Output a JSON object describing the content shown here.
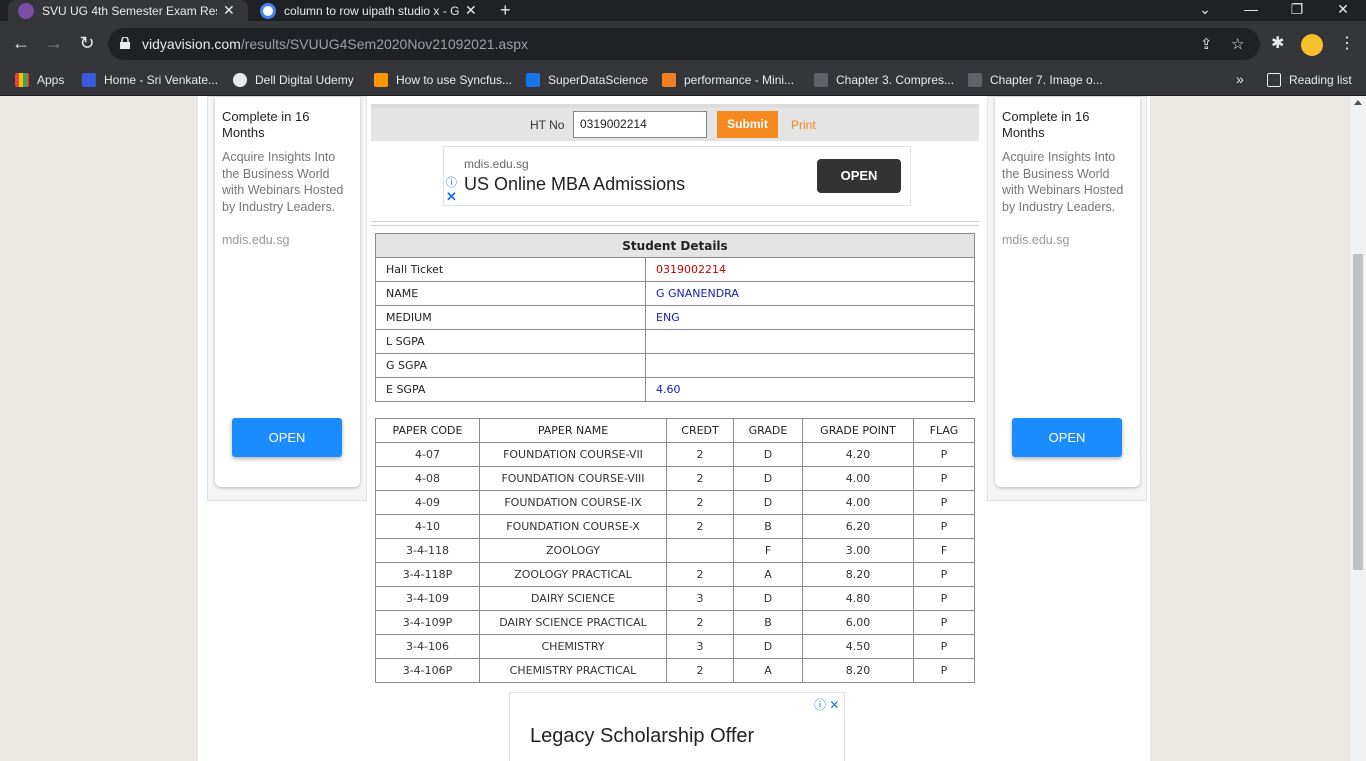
{
  "browser": {
    "tabs": [
      {
        "title": "SVU UG 4th Semester Exam Resu",
        "close": "✕",
        "active": true
      },
      {
        "title": "column to row uipath studio x - G",
        "close": "✕",
        "active": false
      }
    ],
    "new_tab": "+",
    "window_controls": {
      "tabsearch": "⌄",
      "minimize": "—",
      "restore": "❐",
      "close": "✕"
    },
    "url_host": "vidyavision.com",
    "url_path": "/results/SVUUG4Sem2020Nov21092021.aspx",
    "bookmarks": [
      {
        "label": "Apps",
        "color": "#e8453c"
      },
      {
        "label": "Home - Sri Venkate...",
        "color": "#3b5bdb"
      },
      {
        "label": "Dell Digital Udemy",
        "color": "#e8eaed"
      },
      {
        "label": "How to use Syncfus...",
        "color": "#ff9800"
      },
      {
        "label": "SuperDataScience",
        "color": "#1a73e8"
      },
      {
        "label": "performance - Mini...",
        "color": "#f48024"
      },
      {
        "label": "Chapter 3. Compres...",
        "color": "#5f6368"
      },
      {
        "label": "Chapter 7. Image o...",
        "color": "#5f6368"
      }
    ],
    "more_bookmarks": "»",
    "reading_list": "Reading list"
  },
  "side_ad": {
    "title": "Complete in 16 Months",
    "body": "Acquire Insights Into the Business World with Webinars Hosted by Industry Leaders.",
    "domain": "mdis.edu.sg",
    "button": "OPEN"
  },
  "form": {
    "label": "HT No",
    "value": "0319002214",
    "submit": "Submit",
    "print": "Print"
  },
  "top_ad": {
    "domain": "mdis.edu.sg",
    "title": "US Online MBA Admissions",
    "button": "OPEN"
  },
  "details": {
    "heading": "Student Details",
    "rows": [
      {
        "key": "Hall Ticket",
        "value": "0319002214"
      },
      {
        "key": "NAME",
        "value": "G GNANENDRA"
      },
      {
        "key": "MEDIUM",
        "value": "ENG"
      },
      {
        "key": "L SGPA",
        "value": ""
      },
      {
        "key": "G SGPA",
        "value": ""
      },
      {
        "key": "E SGPA",
        "value": "4.60"
      }
    ]
  },
  "marks": {
    "headers": [
      "PAPER CODE",
      "PAPER NAME",
      "CREDT",
      "GRADE",
      "GRADE POINT",
      "FLAG"
    ],
    "rows": [
      [
        "4-07",
        "FOUNDATION COURSE-VII",
        "2",
        "D",
        "4.20",
        "P"
      ],
      [
        "4-08",
        "FOUNDATION COURSE-VIII",
        "2",
        "D",
        "4.00",
        "P"
      ],
      [
        "4-09",
        "FOUNDATION COURSE-IX",
        "2",
        "D",
        "4.00",
        "P"
      ],
      [
        "4-10",
        "FOUNDATION COURSE-X",
        "2",
        "B",
        "6.20",
        "P"
      ],
      [
        "3-4-118",
        "ZOOLOGY",
        "",
        "F",
        "3.00",
        "F"
      ],
      [
        "3-4-118P",
        "ZOOLOGY PRACTICAL",
        "2",
        "A",
        "8.20",
        "P"
      ],
      [
        "3-4-109",
        "DAIRY SCIENCE",
        "3",
        "D",
        "4.80",
        "P"
      ],
      [
        "3-4-109P",
        "DAIRY SCIENCE PRACTICAL",
        "2",
        "B",
        "6.00",
        "P"
      ],
      [
        "3-4-106",
        "CHEMISTRY",
        "3",
        "D",
        "4.50",
        "P"
      ],
      [
        "3-4-106P",
        "CHEMISTRY PRACTICAL",
        "2",
        "A",
        "8.20",
        "P"
      ]
    ]
  },
  "bottom_ad": {
    "title": "Legacy Scholarship Offer"
  }
}
